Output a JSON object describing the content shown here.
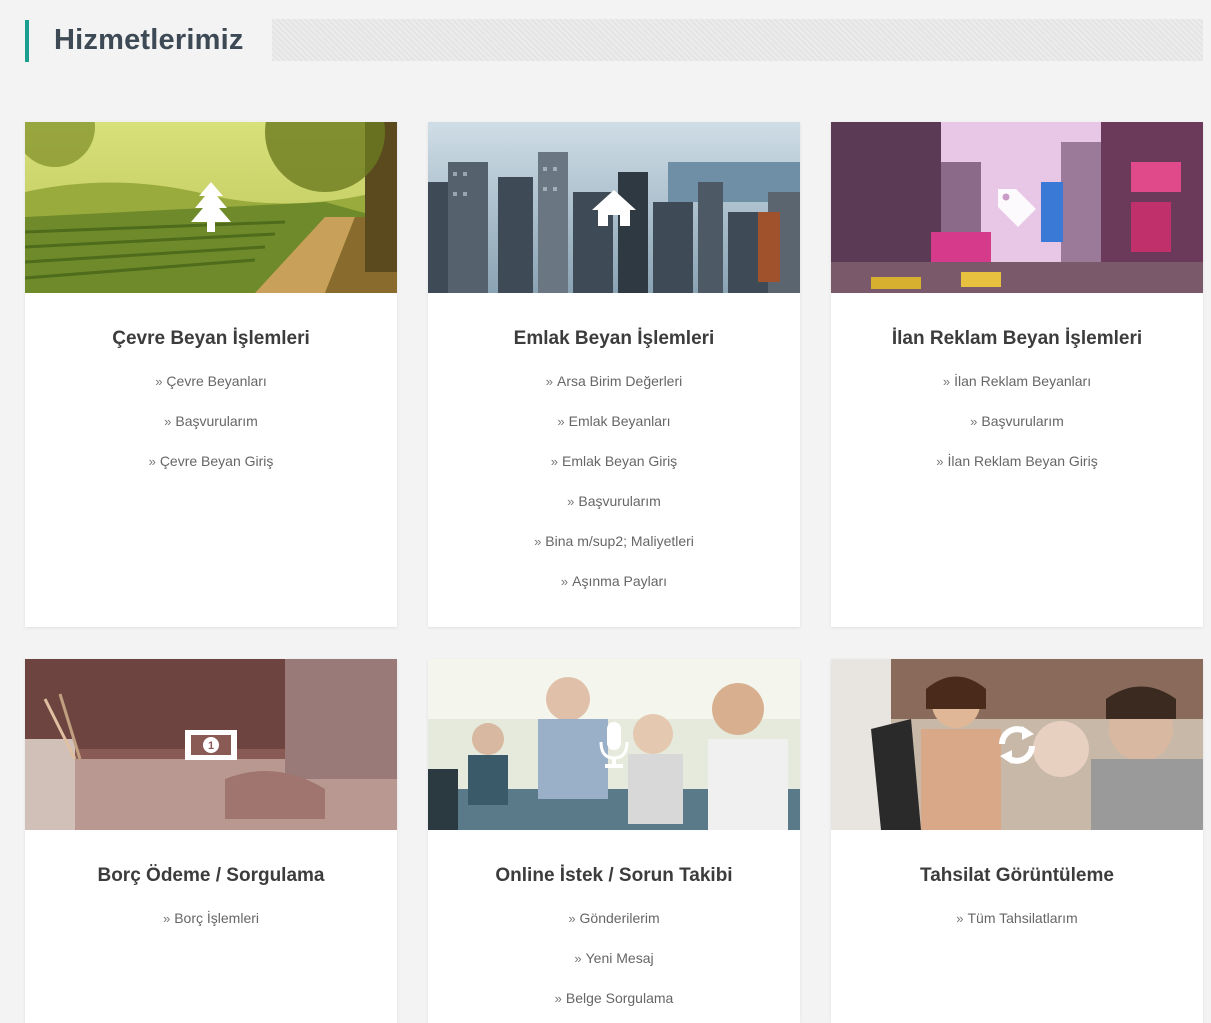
{
  "header": {
    "title": "Hizmetlerimiz"
  },
  "cards": [
    {
      "title": "Çevre Beyan İşlemleri",
      "icon": "tree-icon",
      "links": [
        "Çevre Beyanları",
        "Başvurularım",
        "Çevre Beyan Giriş"
      ]
    },
    {
      "title": "Emlak Beyan İşlemleri",
      "icon": "home-icon",
      "links": [
        "Arsa Birim Değerleri",
        "Emlak Beyanları",
        "Emlak Beyan Giriş",
        "Başvurularım",
        "Bina m/sup2; Maliyetleri",
        "Aşınma Payları"
      ]
    },
    {
      "title": "İlan Reklam Beyan İşlemleri",
      "icon": "tag-icon",
      "links": [
        "İlan Reklam Beyanları",
        "Başvurularım",
        "İlan Reklam Beyan Giriş"
      ]
    },
    {
      "title": "Borç Ödeme / Sorgulama",
      "icon": "money-bill-icon",
      "links": [
        "Borç İşlemleri"
      ]
    },
    {
      "title": "Online İstek / Sorun Takibi",
      "icon": "microphone-icon",
      "links": [
        "Gönderilerim",
        "Yeni Mesaj",
        "Belge Sorgulama"
      ]
    },
    {
      "title": "Tahsilat Görüntüleme",
      "icon": "refresh-icon",
      "links": [
        "Tüm Tahsilatlarım"
      ]
    }
  ],
  "colors": {
    "accent": "#1a9e8f",
    "title_text": "#3d4a55",
    "background": "#f3f3f3"
  },
  "link_prefix": "»"
}
